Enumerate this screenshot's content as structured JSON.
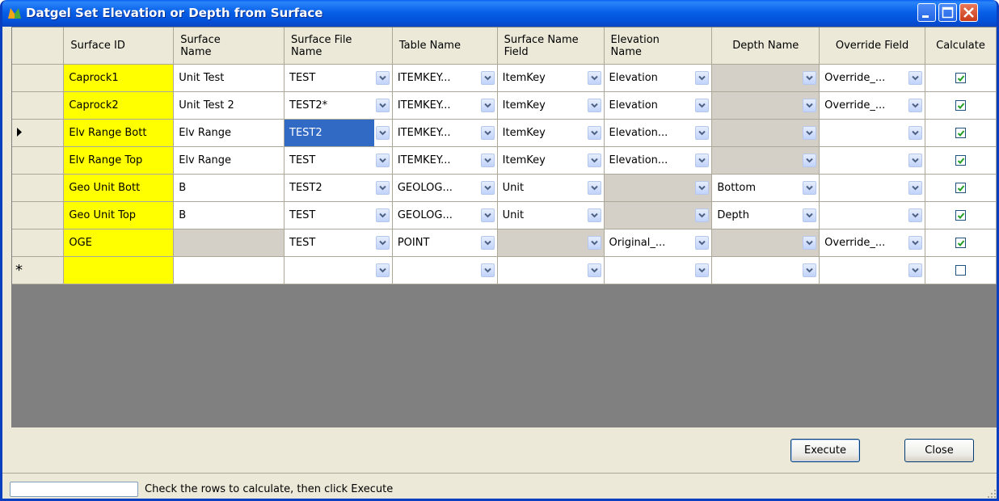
{
  "window": {
    "title": "Datgel Set Elevation or Depth from Surface"
  },
  "columns": [
    "Surface ID",
    "Surface\nName",
    "Surface File\nName",
    "Table Name",
    "Surface Name\nField",
    "Elevation\nName",
    "Depth Name",
    "Override Field",
    "Calculate"
  ],
  "rows": [
    {
      "id": "Caprock1",
      "name": "Unit Test",
      "file": "TEST",
      "table": "ITEMKEY...",
      "field": "ItemKey",
      "elev": "Elevation",
      "depth": "",
      "override": "Override_...",
      "calc": true
    },
    {
      "id": "Caprock2",
      "name": "Unit Test 2",
      "file": "TEST2*",
      "table": "ITEMKEY...",
      "field": "ItemKey",
      "elev": "Elevation",
      "depth": "",
      "override": "Override_...",
      "calc": true
    },
    {
      "id": "Elv Range Bott",
      "name": "Elv Range",
      "file": "TEST2",
      "table": "ITEMKEY...",
      "field": "ItemKey",
      "elev": "Elevation...",
      "depth": "",
      "override": "",
      "calc": true
    },
    {
      "id": "Elv Range Top",
      "name": "Elv Range",
      "file": "TEST",
      "table": "ITEMKEY...",
      "field": "ItemKey",
      "elev": "Elevation...",
      "depth": "",
      "override": "",
      "calc": true
    },
    {
      "id": "Geo Unit Bott",
      "name": "B",
      "file": "TEST2",
      "table": "GEOLOG...",
      "field": "Unit",
      "elev": "",
      "depth": "Bottom",
      "override": "",
      "calc": true
    },
    {
      "id": "Geo Unit Top",
      "name": "B",
      "file": "TEST",
      "table": "GEOLOG...",
      "field": "Unit",
      "elev": "",
      "depth": "Depth",
      "override": "",
      "calc": true
    },
    {
      "id": "OGE",
      "name": "",
      "file": "TEST",
      "table": "POINT",
      "field": "",
      "elev": "Original_...",
      "depth": "",
      "override": "Override_...",
      "calc": true
    }
  ],
  "new_row_marker": "*",
  "buttons": {
    "execute": "Execute",
    "close": "Close"
  },
  "status": {
    "text": "Check the rows to calculate, then click Execute"
  },
  "colors": {
    "id_cell": "#FFFF00",
    "disabled_cell": "#D4D0C8",
    "selection": "#316AC5",
    "titlebar": "#0A5EF2"
  }
}
